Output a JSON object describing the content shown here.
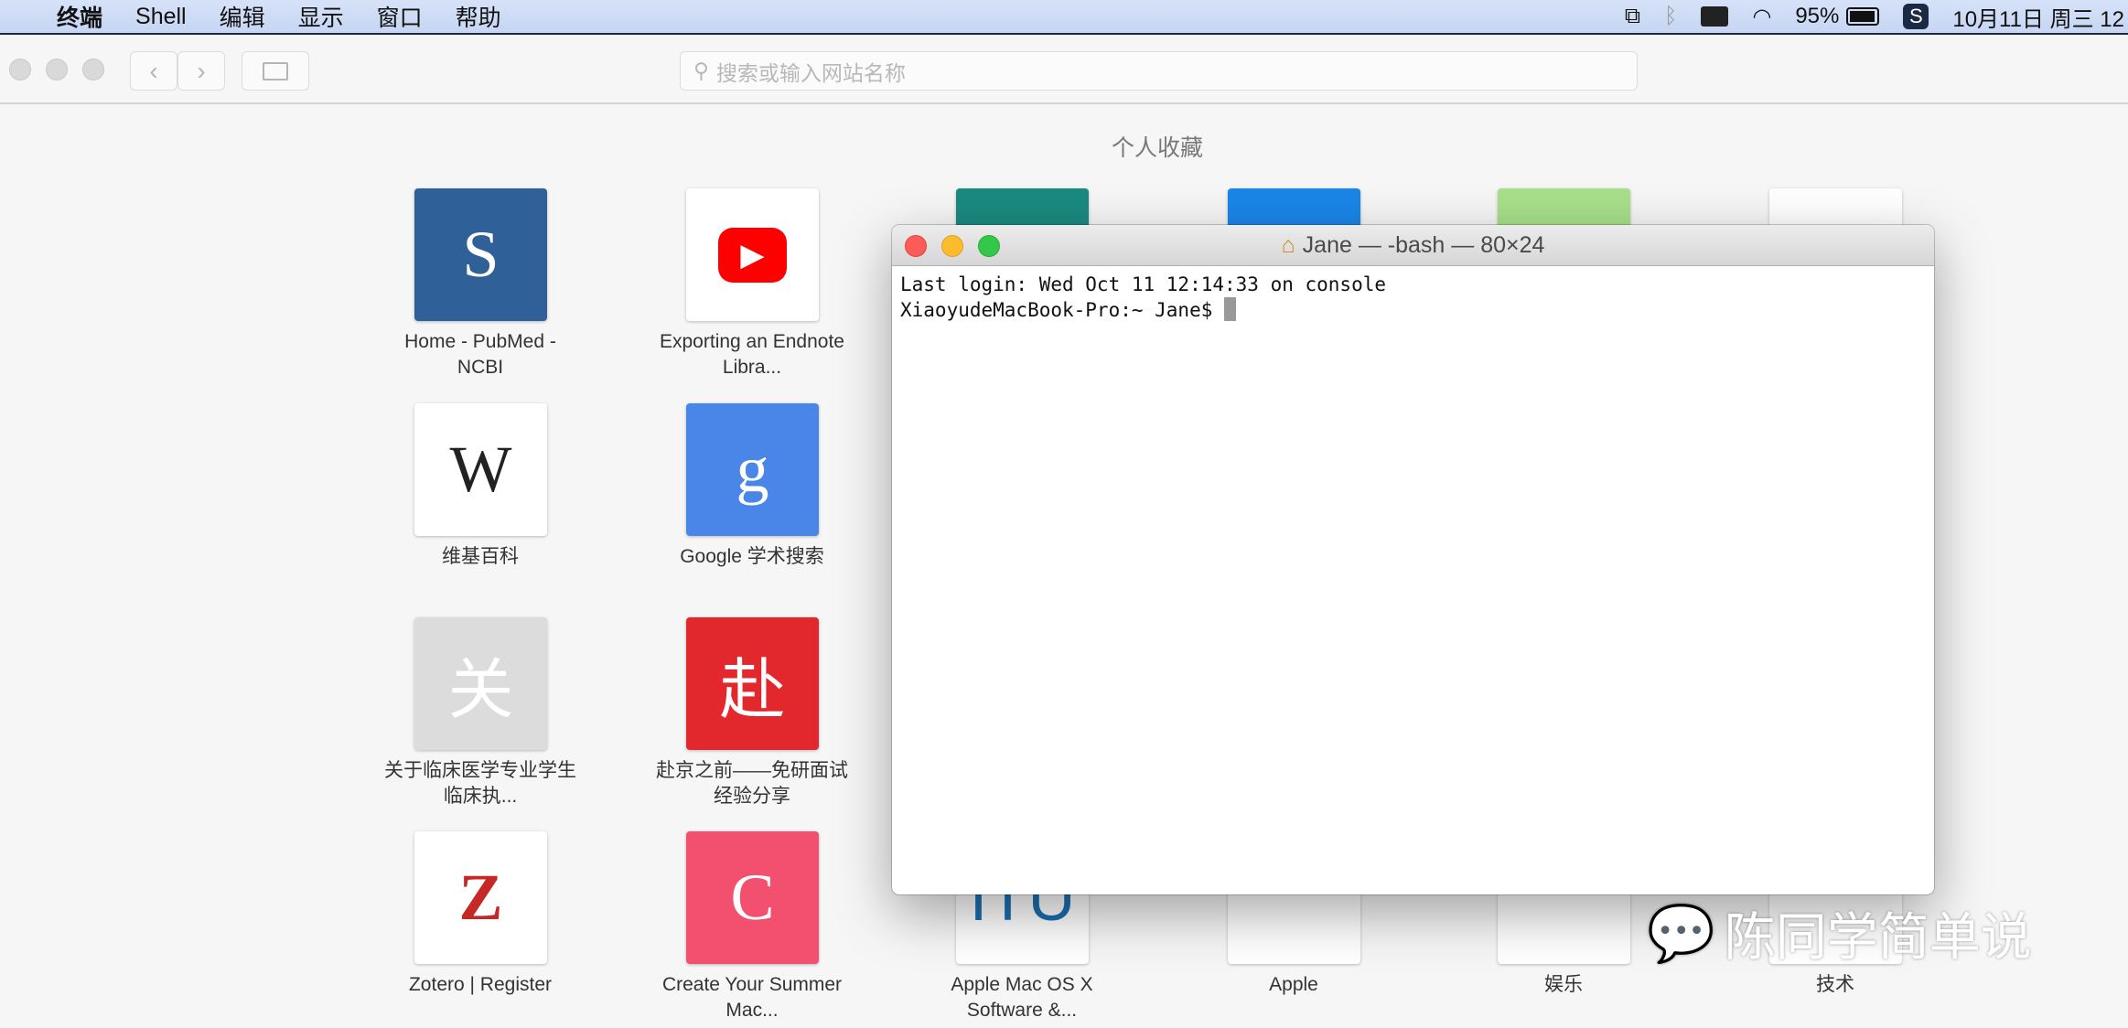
{
  "menubar": {
    "apple": "",
    "items": [
      "终端",
      "Shell",
      "编辑",
      "显示",
      "窗口",
      "帮助"
    ],
    "battery": "95%",
    "clock": "10月11日 周三 12"
  },
  "safari": {
    "search_placeholder": "搜索或输入网站名称",
    "favorites_title": "个人收藏",
    "tiles": [
      {
        "label": "Home - PubMed - NCBI",
        "color": "#2f6097",
        "glyph": "S"
      },
      {
        "label": "Exporting an Endnote Libra...",
        "color": "#ffffff",
        "glyph": "▶"
      },
      {
        "label": "",
        "color": "#1a8a80",
        "glyph": ""
      },
      {
        "label": "",
        "color": "#1a86e8",
        "glyph": ""
      },
      {
        "label": "",
        "color": "#a8e08a",
        "glyph": ""
      },
      {
        "label": "",
        "color": "#ffffff",
        "glyph": ""
      },
      {
        "label": "维基百科",
        "color": "#ffffff",
        "glyph": "W"
      },
      {
        "label": "Google 学术搜索",
        "color": "#4a86e8",
        "glyph": "g"
      },
      {
        "label": "关于临床医学专业学生临床执...",
        "color": "#dcdcdc",
        "glyph": "关"
      },
      {
        "label": "赴京之前——免研面试经验分享",
        "color": "#e2282d",
        "glyph": "赴"
      },
      {
        "label": "Zotero | Register",
        "color": "#ffffff",
        "glyph": "Z"
      },
      {
        "label": "Create Your Summer Mac...",
        "color": "#f2506e",
        "glyph": "C"
      },
      {
        "label": "Apple Mac OS X Software &...",
        "color": "#ffffff",
        "glyph": "ITU"
      },
      {
        "label": "Apple",
        "color": "#ffffff",
        "glyph": ""
      },
      {
        "label": "娱乐",
        "color": "#ffffff",
        "glyph": ""
      },
      {
        "label": "技术",
        "color": "#ffffff",
        "glyph": ""
      }
    ]
  },
  "terminal": {
    "title": "Jane — -bash — 80×24",
    "lines": [
      "Last login: Wed Oct 11 12:14:33 on console",
      "XiaoyudeMacBook-Pro:~ Jane$ "
    ]
  },
  "watermark": "陈同学简单说"
}
